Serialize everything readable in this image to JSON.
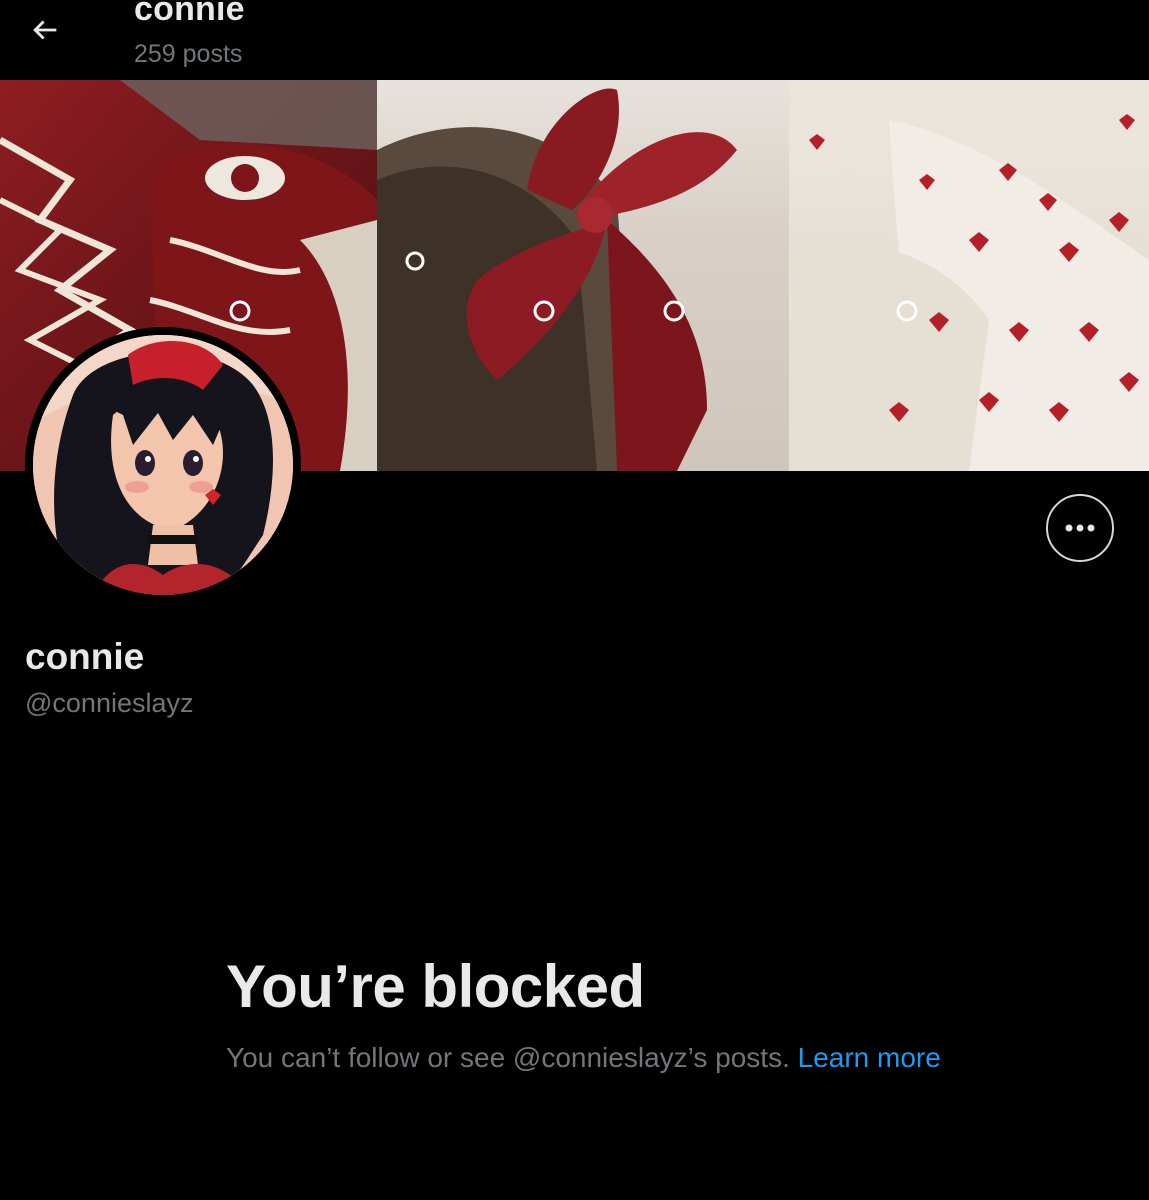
{
  "header": {
    "title": "connie",
    "post_count": "259 posts",
    "back_icon": "arrow-left-icon"
  },
  "profile": {
    "display_name": "connie",
    "handle": "@connieslayz",
    "more_icon": "more-dots-icon"
  },
  "blocked": {
    "title": "You’re blocked",
    "message": "You can’t follow or see @connieslayz’s posts.",
    "link_label": "Learn more"
  },
  "colors": {
    "background": "#000000",
    "text_primary": "#e7e9ea",
    "text_secondary": "#71767b",
    "link": "#1d9bf0"
  }
}
